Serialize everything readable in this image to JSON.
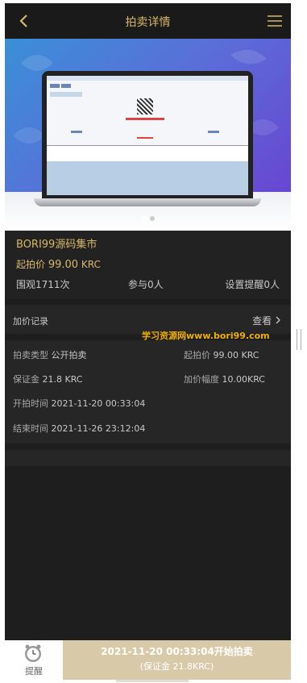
{
  "header": {
    "title": "拍卖详情",
    "back_icon": "back-icon",
    "menu_icon": "menu-icon"
  },
  "banner": {
    "slide_count": 2,
    "active_slide": 1
  },
  "item": {
    "title": "BORI99源码集市",
    "start_price_label": "起拍价",
    "start_price_value": "99.00",
    "start_price_unit": "KRC",
    "views": "围观1711次",
    "participants": "参与0人",
    "reminders": "设置提醒0人"
  },
  "bid_record": {
    "label": "加价记录",
    "link": "查看"
  },
  "watermark": "学习资源网www.bori99.com",
  "details": {
    "type_label": "拍卖类型",
    "type_value": "公开拍卖",
    "start_price_label": "起拍价",
    "start_price_value": "99.00 KRC",
    "deposit_label": "保证金",
    "deposit_value": "21.8 KRC",
    "increment_label": "加价幅度",
    "increment_value": "10.00KRC",
    "start_time_label": "开拍时间",
    "start_time_value": "2021-11-20 00:33:04",
    "end_time_label": "结束时间",
    "end_time_value": "2021-11-26 23:12:04"
  },
  "bottom_bar": {
    "remind_label": "提醒",
    "cta_line1": "2021-11-20 00:33:04开始拍卖",
    "cta_line2": "(保证金 21.8KRC)"
  },
  "colors": {
    "accent": "#d8b76a",
    "background": "#1e1e1e",
    "cta": "#d8c9a8"
  }
}
